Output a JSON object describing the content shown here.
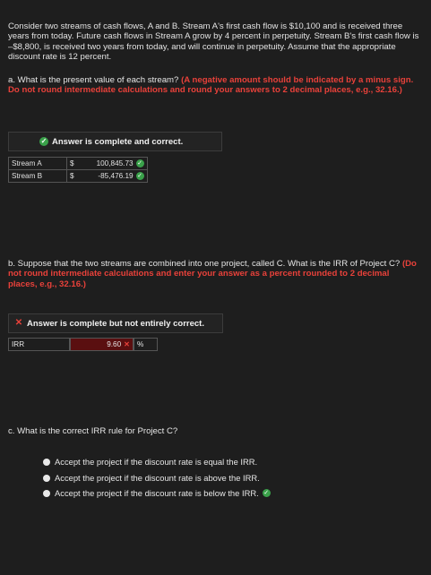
{
  "intro": "Consider two streams of cash flows, A and B. Stream A's first cash flow is $10,100 and is received three years from today. Future cash flows in Stream A grow by 4 percent in perpetuity. Stream B's first cash flow is –$8,800, is received two years from today, and will continue in perpetuity. Assume that the appropriate discount rate is 12 percent.",
  "part_a": {
    "question": "a. What is the present value of each stream?",
    "instruction": "(A negative amount should be indicated by a minus sign. Do not round intermediate calculations and round your answers to 2 decimal places, e.g., 32.16.)",
    "banner": "Answer is complete and correct.",
    "rows": [
      {
        "label": "Stream A",
        "currency": "$",
        "value": "100,845.73"
      },
      {
        "label": "Stream B",
        "currency": "$",
        "value": "-85,476.19"
      }
    ]
  },
  "part_b": {
    "question": "b. Suppose that the two streams are combined into one project, called C. What is the IRR of Project C?",
    "instruction": "(Do not round intermediate calculations and enter your answer as a percent rounded to 2 decimal places, e.g., 32.16.)",
    "banner": "Answer is complete but not entirely correct.",
    "irr_label": "IRR",
    "irr_value": "9.60",
    "irr_unit": "%"
  },
  "part_c": {
    "question": "c. What is the correct IRR rule for Project C?",
    "options": [
      "Accept the project if the discount rate is equal the IRR.",
      "Accept the project if the discount rate is above the IRR.",
      "Accept the project if the discount rate is below the IRR."
    ],
    "selected_index": 2
  },
  "colors": {
    "background": "#1e1e1e",
    "error": "#e8413a",
    "correct": "#3aa14a",
    "wrong_fill": "#5a0f10"
  }
}
